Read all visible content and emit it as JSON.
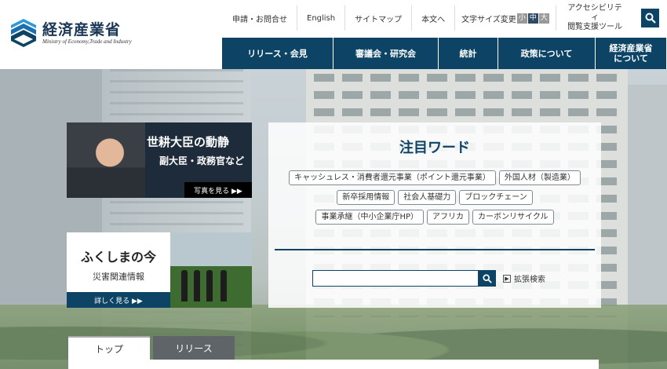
{
  "header": {
    "logo_jp": "経済産業省",
    "logo_en": "Ministry of Economy,Trade and Industry",
    "util_links": [
      "申請・お問合せ",
      "English",
      "サイトマップ",
      "本文へ"
    ],
    "font_size_label": "文字サイズ変更",
    "font_sizes": [
      "小",
      "中",
      "大"
    ],
    "accessibility_line1": "アクセシビリティ",
    "accessibility_line2": "閲覧支援ツール"
  },
  "gnav": {
    "items": [
      "リリース・会見",
      "審議会・研究会",
      "統計",
      "政策について",
      "経済産業省"
    ],
    "last_line2": "について"
  },
  "minister_card": {
    "title": "世耕大臣の動静",
    "subtitle": "副大臣・政務官など",
    "more": "写真を見る ▶▶"
  },
  "fukushima_card": {
    "title": "ふくしまの今",
    "subtitle": "災害関連情報",
    "more": "詳しく見る ▶▶"
  },
  "keywords": {
    "title": "注目ワード",
    "rows": [
      [
        "キャッシュレス・消費者還元事業（ポイント還元事業）",
        "外国人材（製造業）"
      ],
      [
        "新卒採用情報",
        "社会人基礎力",
        "ブロックチェーン"
      ],
      [
        "事業承継（中小企業庁HP）",
        "アフリカ",
        "カーボンリサイクル"
      ]
    ]
  },
  "search": {
    "value": "",
    "advanced": "拡張検索"
  },
  "tabs": [
    "トップ",
    "リリース"
  ],
  "colors": {
    "brand": "#0d4466"
  }
}
